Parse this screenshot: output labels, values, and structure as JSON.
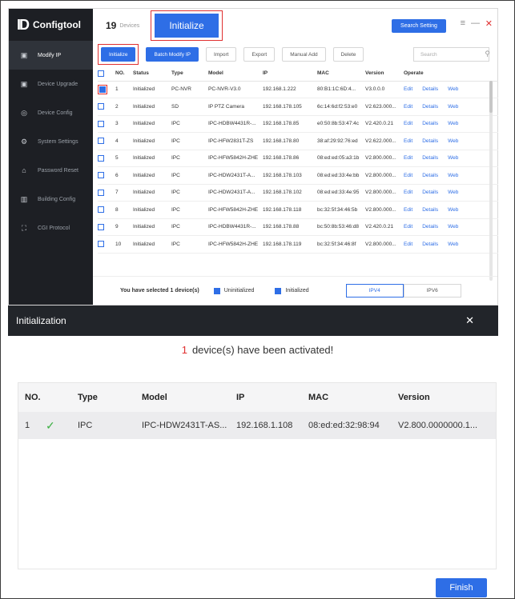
{
  "app": {
    "name": "Configtool",
    "logo_mark": "ID",
    "device_count": "19",
    "device_count_label": "Devices",
    "initialize_big": "Initialize",
    "search_setting": "Search Setting"
  },
  "sidebar": {
    "items": [
      {
        "label": "Modify IP",
        "icon": "▣"
      },
      {
        "label": "Device Upgrade",
        "icon": "▣"
      },
      {
        "label": "Device Config",
        "icon": "◎"
      },
      {
        "label": "System Settings",
        "icon": "⚙"
      },
      {
        "label": "Password Reset",
        "icon": "⌂"
      },
      {
        "label": "Building Config",
        "icon": "▥"
      },
      {
        "label": "CGI Protocol",
        "icon": "⛶"
      }
    ]
  },
  "toolbar": {
    "initialize": "Initialize",
    "batch_modify": "Batch Modify IP",
    "import": "Import",
    "export": "Export",
    "manual_add": "Manual Add",
    "delete": "Delete",
    "search_placeholder": "Search"
  },
  "table": {
    "headers": [
      "NO.",
      "Status",
      "Type",
      "Model",
      "IP",
      "MAC",
      "Version",
      "Operate"
    ],
    "rows": [
      {
        "no": "1",
        "status": "Initialized",
        "type": "PC-NVR",
        "model": "PC-NVR-V3.0",
        "ip": "192.168.1.222",
        "mac": "80:B1:1C:6D:4...",
        "version": "V3.0.0.0"
      },
      {
        "no": "2",
        "status": "Initialized",
        "type": "SD",
        "model": "IP PTZ Camera",
        "ip": "192.168.178.105",
        "mac": "6c:14:6d:f2:53:e0",
        "version": "V2.623.000..."
      },
      {
        "no": "3",
        "status": "Initialized",
        "type": "IPC",
        "model": "IPC-HDBW4431R-...",
        "ip": "192.168.178.85",
        "mac": "e0:50:8b:53:47:4c",
        "version": "V2.420.0.21"
      },
      {
        "no": "4",
        "status": "Initialized",
        "type": "IPC",
        "model": "IPC-HFW2831T-ZS",
        "ip": "192.168.178.80",
        "mac": "38:af:29:92:76:ed",
        "version": "V2.622.000..."
      },
      {
        "no": "5",
        "status": "Initialized",
        "type": "IPC",
        "model": "IPC-HFW5842H-ZHE",
        "ip": "192.168.178.86",
        "mac": "08:ed:ed:05:a3:1b",
        "version": "V2.800.000..."
      },
      {
        "no": "6",
        "status": "Initialized",
        "type": "IPC",
        "model": "IPC-HDW2431T-A...",
        "ip": "192.168.178.103",
        "mac": "08:ed:ed:33:4e:bb",
        "version": "V2.800.000..."
      },
      {
        "no": "7",
        "status": "Initialized",
        "type": "IPC",
        "model": "IPC-HDW2431T-A...",
        "ip": "192.168.178.102",
        "mac": "08:ed:ed:33:4e:95",
        "version": "V2.800.000..."
      },
      {
        "no": "8",
        "status": "Initialized",
        "type": "IPC",
        "model": "IPC-HFW5842H-ZHE",
        "ip": "192.168.178.118",
        "mac": "bc:32:5f:34:46:5b",
        "version": "V2.800.000..."
      },
      {
        "no": "9",
        "status": "Initialized",
        "type": "IPC",
        "model": "IPC-HDBW4431R-...",
        "ip": "192.168.178.88",
        "mac": "bc:50:8b:53:46:d8",
        "version": "V2.420.0.21"
      },
      {
        "no": "10",
        "status": "Initialized",
        "type": "IPC",
        "model": "IPC-HFW5842H-ZHE",
        "ip": "192.168.178.119",
        "mac": "bc:32:5f:34:46:8f",
        "version": "V2.800.000..."
      }
    ],
    "ops": {
      "edit": "Edit",
      "details": "Details",
      "web": "Web"
    }
  },
  "footer": {
    "selected": "You have selected 1 device(s)",
    "uninitialized": "Uninitialized",
    "initialized": "Initialized",
    "ipv4": "IPV4",
    "ipv6": "IPV6"
  },
  "dialog": {
    "title": "Initialization",
    "activated_count": "1",
    "activated_msg": "device(s) have been activated!",
    "headers": {
      "no": "NO.",
      "type": "Type",
      "model": "Model",
      "ip": "IP",
      "mac": "MAC",
      "version": "Version"
    },
    "row": {
      "no": "1",
      "type": "IPC",
      "model": "IPC-HDW2431T-AS...",
      "ip": "192.168.1.108",
      "mac": "08:ed:ed:32:98:94",
      "version": "V2.800.0000000.1..."
    },
    "finish": "Finish"
  },
  "colors": {
    "accent": "#2e6ee6",
    "highlight": "#e03030",
    "success": "#3cb043"
  }
}
